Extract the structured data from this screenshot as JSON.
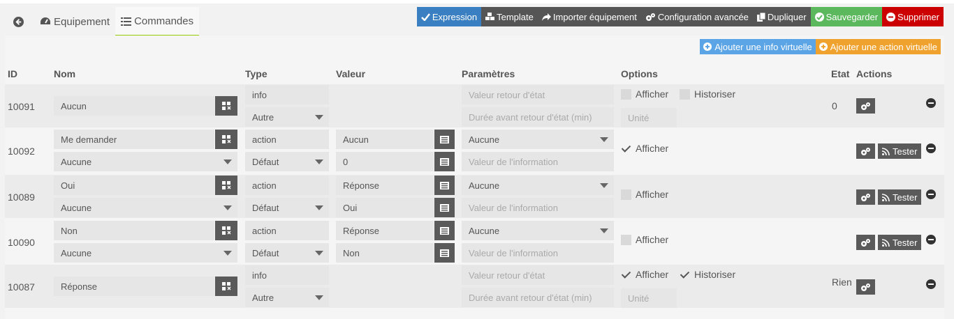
{
  "tabs": {
    "back_icon": "arrow-circle-left-icon",
    "equipement": "Equipement",
    "commandes": "Commandes"
  },
  "header_buttons": [
    {
      "label": "Expression",
      "icon": "check-icon",
      "color": "#3a7fc1"
    },
    {
      "label": "Template",
      "icon": "cubes-icon",
      "color": "#555555"
    },
    {
      "label": "Importer équipement",
      "icon": "share-icon",
      "color": "#555555"
    },
    {
      "label": "Configuration avancée",
      "icon": "cogs-icon",
      "color": "#555555"
    },
    {
      "label": "Dupliquer",
      "icon": "copy-icon",
      "color": "#555555"
    },
    {
      "label": "Sauvegarder",
      "icon": "check-circle-icon",
      "color": "#5cb85c"
    },
    {
      "label": "Supprimer",
      "icon": "minus-circle-icon",
      "color": "#cc0000"
    }
  ],
  "add_buttons": {
    "info": {
      "label": "Ajouter une info virtuelle",
      "color": "#5ba4e6"
    },
    "action": {
      "label": "Ajouter une action virtuelle",
      "color": "#f0a22e"
    }
  },
  "columns": [
    "ID",
    "Nom",
    "Type",
    "Valeur",
    "Paramètres",
    "Options",
    "Etat",
    "Actions"
  ],
  "rows": [
    {
      "id": "10091",
      "kind": "info",
      "name": "Aucun",
      "type": "info",
      "subtype": "Autre",
      "param1": "Valeur retour d'état",
      "param2": "Durée avant retour d'état (min)",
      "afficher": false,
      "historiser": false,
      "historiser_label": "Historiser",
      "unite": "Unité",
      "etat": "0"
    },
    {
      "id": "10092",
      "kind": "action",
      "name": "Me demander",
      "name_select": "Aucune",
      "type": "action",
      "subtype": "Défaut",
      "value1": "Aucun",
      "value2": "0",
      "param_select": "Aucune",
      "param2": "Valeur de l'information",
      "afficher": true,
      "test_label": "Tester"
    },
    {
      "id": "10089",
      "kind": "action",
      "name": "Oui",
      "name_select": "Aucune",
      "type": "action",
      "subtype": "Défaut",
      "value1": "Réponse",
      "value2": "Oui",
      "param_select": "Aucune",
      "param2": "Valeur de l'information",
      "afficher": false,
      "test_label": "Tester"
    },
    {
      "id": "10090",
      "kind": "action",
      "name": "Non",
      "name_select": "Aucune",
      "type": "action",
      "subtype": "Défaut",
      "value1": "Réponse",
      "value2": "Non",
      "param_select": "Aucune",
      "param2": "Valeur de l'information",
      "afficher": false,
      "test_label": "Tester"
    },
    {
      "id": "10087",
      "kind": "info",
      "name": "Réponse",
      "type": "info",
      "subtype": "Autre",
      "param1": "Valeur retour d'état",
      "param2": "Durée avant retour d'état (min)",
      "afficher": true,
      "historiser": true,
      "historiser_label": "Historiser",
      "unite": "Unité",
      "etat": "Rien"
    }
  ],
  "afficher_label": "Afficher"
}
